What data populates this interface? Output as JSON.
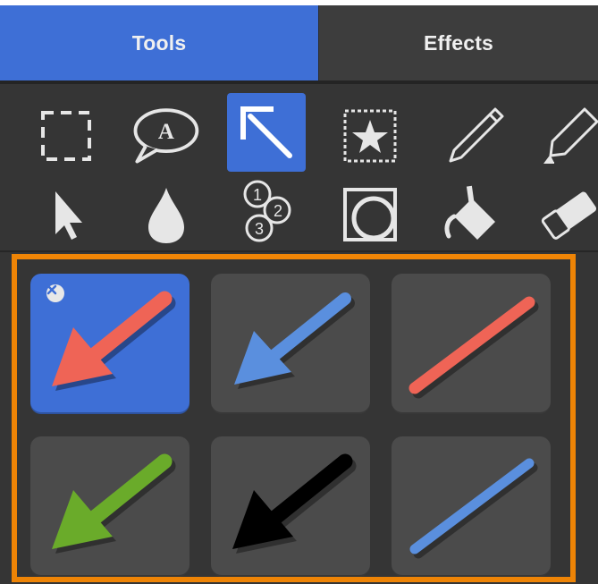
{
  "tabs": [
    {
      "label": "Tools",
      "active": true
    },
    {
      "label": "Effects",
      "active": false
    }
  ],
  "tools": {
    "row1": [
      "selection-rectangle-icon",
      "speech-bubble-text-icon",
      "arrow-icon",
      "stamp-icon",
      "pen-icon",
      "highlighter-icon"
    ],
    "row2": [
      "cursor-icon",
      "blur-drop-icon",
      "counter-numbers-icon",
      "shape-icon",
      "fill-bucket-icon",
      "eraser-icon"
    ],
    "speech_bubble_letter": "A",
    "counter_numbers": [
      "1",
      "2",
      "3"
    ],
    "active_tool": "arrow-icon"
  },
  "presets": [
    {
      "name": "red-arrow",
      "color": "#ef6456",
      "type": "arrow",
      "selected": true
    },
    {
      "name": "blue-arrow",
      "color": "#5a8fde",
      "type": "arrow",
      "selected": false
    },
    {
      "name": "red-line",
      "color": "#ef6456",
      "type": "line",
      "selected": false
    },
    {
      "name": "green-arrow",
      "color": "#6aab2a",
      "type": "arrow",
      "selected": false
    },
    {
      "name": "black-arrow",
      "color": "#000000",
      "type": "arrow",
      "selected": false
    },
    {
      "name": "blue-line",
      "color": "#5a8fde",
      "type": "line",
      "selected": false
    }
  ],
  "colors": {
    "accent": "#3e6fd6",
    "panel": "#353535",
    "highlight_border": "#ee8406"
  }
}
